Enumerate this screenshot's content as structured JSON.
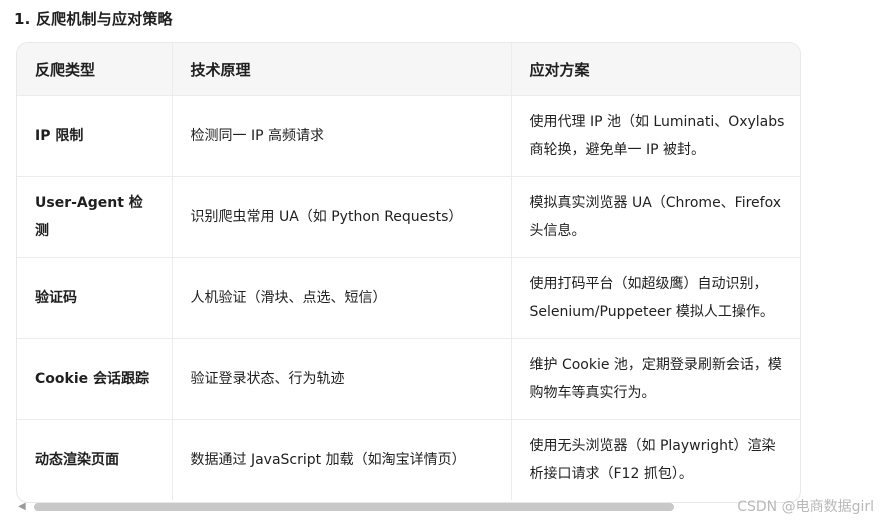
{
  "heading": "1. 反爬机制与应对策略",
  "table": {
    "headers": [
      "反爬类型",
      "技术原理",
      "应对方案"
    ],
    "rows": [
      {
        "type": "IP 限制",
        "principle": "检测同一 IP 高频请求",
        "solution": [
          "使用代理 IP 池（如 Luminati、Oxylabs",
          "商轮换，避免单一 IP 被封。"
        ]
      },
      {
        "type": "User-Agent 检测",
        "principle": "识别爬虫常用 UA（如 Python Requests）",
        "solution": [
          "模拟真实浏览器 UA（Chrome、Firefox",
          "头信息。"
        ]
      },
      {
        "type": "验证码",
        "principle": "人机验证（滑块、点选、短信）",
        "solution": [
          "使用打码平台（如超级鹰）自动识别，",
          "Selenium/Puppeteer 模拟人工操作。"
        ]
      },
      {
        "type": "Cookie 会话跟踪",
        "principle": "验证登录状态、行为轨迹",
        "solution": [
          "维护 Cookie 池，定期登录刷新会话，模",
          "购物车等真实行为。"
        ]
      },
      {
        "type": "动态渲染页面",
        "principle": "数据通过 JavaScript 加载（如淘宝详情页）",
        "solution": [
          "使用无头浏览器（如 Playwright）渲染",
          "析接口请求（F12 抓包）。"
        ]
      }
    ]
  },
  "scrollbar": {
    "left_arrow": "◀"
  },
  "watermark": "CSDN @电商数据girl"
}
